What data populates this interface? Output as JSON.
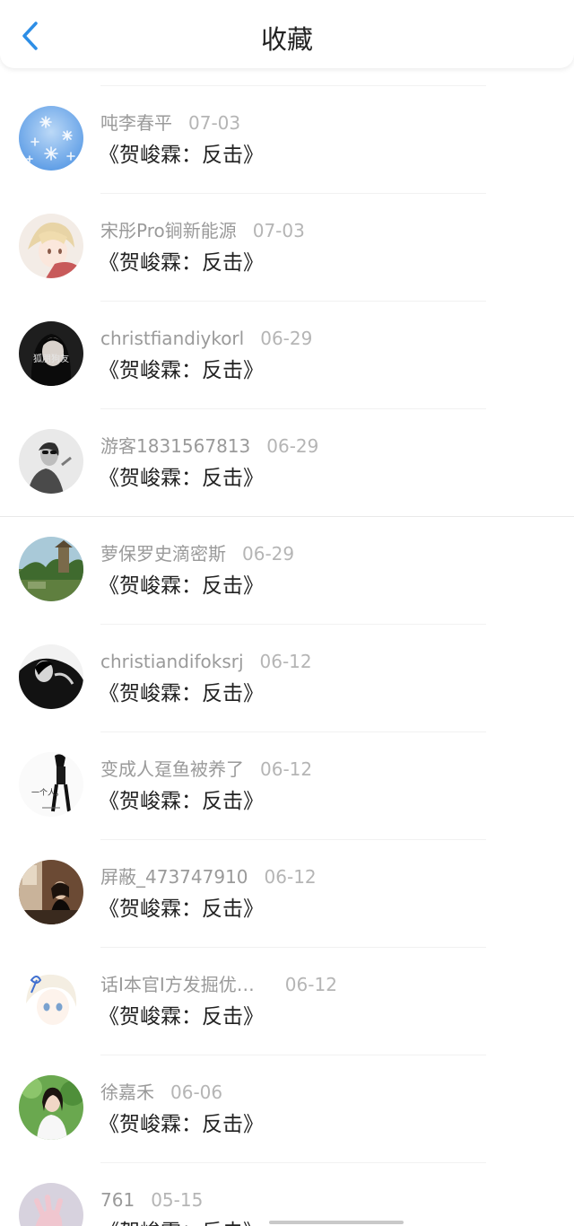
{
  "header": {
    "title": "收藏",
    "back_icon": "chevron-left-icon",
    "back_color": "#2d8ee6"
  },
  "favorites": [
    {
      "name": "吨李春平",
      "date": "07-03",
      "title": "《贺峻霖：反击》",
      "avatar": "snowflake"
    },
    {
      "name": "宋彤Pro锏新能源",
      "date": "07-03",
      "title": "《贺峻霖：反击》",
      "avatar": "anime-boy"
    },
    {
      "name": "christfiandiykorl",
      "date": "06-29",
      "title": "《贺峻霖：反击》",
      "avatar": "dark-portrait",
      "avatar_text": "狐朋狗友"
    },
    {
      "name": "游客1831567813",
      "date": "06-29",
      "title": "《贺峻霖：反击》",
      "avatar": "bw-sunglasses"
    },
    {
      "name": "萝保罗史滴密斯",
      "date": "06-29",
      "title": "《贺峻霖：反击》",
      "avatar": "landscape"
    },
    {
      "name": "christiandifoksrj",
      "date": "06-12",
      "title": "《贺峻霖：反击》",
      "avatar": "bw-hug"
    },
    {
      "name": "变成人趸鱼被养了",
      "date": "06-12",
      "title": "《贺峻霖：反击》",
      "avatar": "sketch",
      "avatar_text": "一个人。"
    },
    {
      "name": "屏蔽_473747910",
      "date": "06-12",
      "title": "《贺峻霖：反击》",
      "avatar": "cafe-photo"
    },
    {
      "name": "话I本官I方发掘优…",
      "date": "06-12",
      "title": "《贺峻霖：反击》",
      "avatar": "anime-girl"
    },
    {
      "name": "徐嘉禾",
      "date": "06-06",
      "title": "《贺峻霖：反击》",
      "avatar": "girl-green"
    },
    {
      "name": "761",
      "date": "05-15",
      "title": "《贺峻霖：反击》",
      "avatar": "pink-hand"
    }
  ]
}
